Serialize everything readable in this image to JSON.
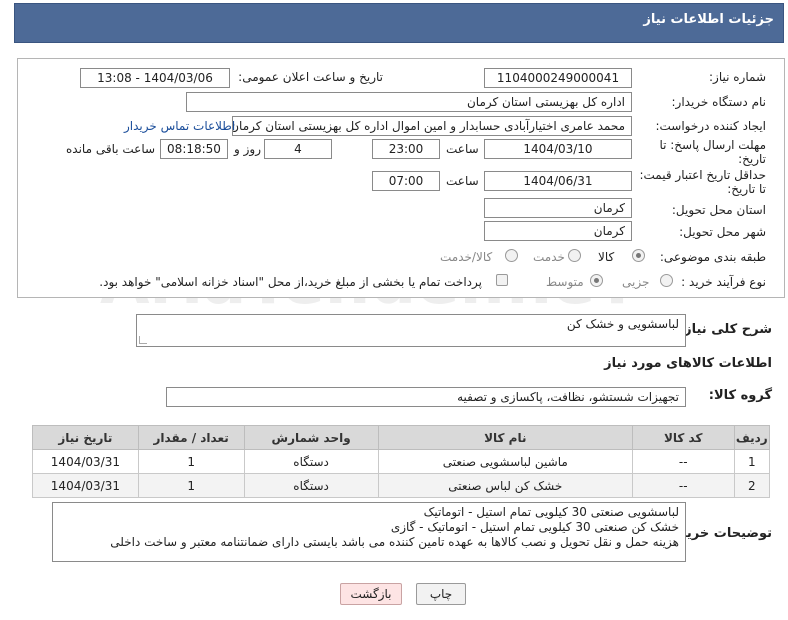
{
  "header": {
    "title": "جزئیات اطلاعات نیاز"
  },
  "watermark": "AriaTender.neT",
  "form": {
    "need_number_label": "شماره نیاز:",
    "need_number": "1104000249000041",
    "announce_label": "تاریخ و ساعت اعلان عمومی:",
    "announce_value": "1404/03/06 - 13:08",
    "buyer_org_label": "نام دستگاه خریدار:",
    "buyer_org": "اداره کل بهزیستی استان کرمان",
    "creator_label": "ایجاد کننده درخواست:",
    "creator": "محمد عامری اختیارآبادی حسابدار و امین اموال اداره کل بهزیستی استان کرمان",
    "contact_link": "اطلاعات تماس خریدار",
    "deadline_label_1": "مهلت ارسال پاسخ: تا",
    "deadline_label_2": "تاریخ:",
    "deadline_date": "1404/03/10",
    "time_label": "ساعت",
    "deadline_time": "23:00",
    "days_value": "4",
    "days_label": "روز و",
    "remaining_time": "08:18:50",
    "remaining_label": "ساعت باقی مانده",
    "min_price_label_1": "حداقل تاریخ اعتبار قیمت:",
    "min_price_label_2": "تا تاریخ:",
    "price_date": "1404/06/31",
    "price_time": "07:00",
    "province_label": "استان محل تحویل:",
    "province": "کرمان",
    "city_label": "شهر محل تحویل:",
    "city": "کرمان",
    "category_label": "طبقه بندی موضوعی:",
    "category_options": [
      "کالا",
      "خدمت",
      "کالا/خدمت"
    ],
    "process_label": "نوع فرآیند خرید :",
    "process_options": [
      "جزیی",
      "متوسط"
    ],
    "payment_note": "پرداخت تمام یا بخشی از مبلغ خرید،از محل \"اسناد خزانه اسلامی\" خواهد بود."
  },
  "description": {
    "label": "شرح کلی نیاز:",
    "value": "لباسشویی و خشک کن"
  },
  "goods_section": {
    "title": "اطلاعات کالاهای مورد نیاز",
    "group_label": "گروه کالا:",
    "group_value": "تجهیزات شستشو، نظافت، پاکسازی و تصفیه"
  },
  "table": {
    "headers": [
      "ردیف",
      "کد کالا",
      "نام کالا",
      "واحد شمارش",
      "تعداد / مقدار",
      "تاریخ نیاز"
    ],
    "rows": [
      [
        "1",
        "--",
        "ماشین لباسشویی صنعتی",
        "دستگاه",
        "1",
        "1404/03/31"
      ],
      [
        "2",
        "--",
        "خشک کن لباس صنعتی",
        "دستگاه",
        "1",
        "1404/03/31"
      ]
    ]
  },
  "buyer_notes": {
    "label": "توضیحات خریدار:",
    "lines": [
      "لباسشویی صنعتی 30 کیلویی تمام استیل - اتوماتیک",
      "خشک کن صنعتی 30 کیلویی تمام استیل - اتوماتیک - گازی",
      "هزینه حمل و نقل تحویل و نصب کالاها به عهده تامین کننده می باشد بایستی دارای ضمانتنامه معتبر و ساخت داخلی"
    ]
  },
  "buttons": {
    "print": "چاپ",
    "back": "بازگشت"
  }
}
